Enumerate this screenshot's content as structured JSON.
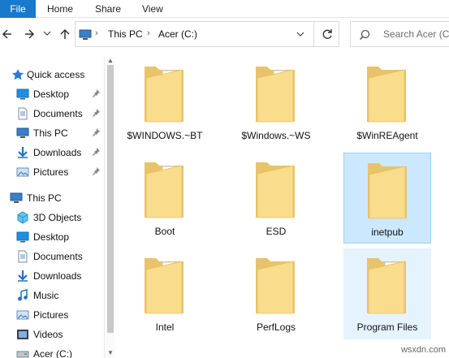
{
  "ribbon": {
    "tabs": [
      {
        "label": "File"
      },
      {
        "label": "Home"
      },
      {
        "label": "Share"
      },
      {
        "label": "View"
      }
    ]
  },
  "address": {
    "crumbs": [
      "This PC",
      "Acer (C:)"
    ],
    "search_placeholder": "Search Acer (C:)"
  },
  "sidebar": {
    "quick_access_label": "Quick access",
    "quick_items": [
      {
        "label": "Desktop",
        "icon": "desktop-icon",
        "pinned": true
      },
      {
        "label": "Documents",
        "icon": "documents-icon",
        "pinned": true
      },
      {
        "label": "This PC",
        "icon": "pc-icon",
        "pinned": true
      },
      {
        "label": "Downloads",
        "icon": "downloads-icon",
        "pinned": true
      },
      {
        "label": "Pictures",
        "icon": "pictures-icon",
        "pinned": true
      }
    ],
    "this_pc_label": "This PC",
    "pc_items": [
      {
        "label": "3D Objects",
        "icon": "3d-objects-icon"
      },
      {
        "label": "Desktop",
        "icon": "desktop-icon"
      },
      {
        "label": "Documents",
        "icon": "documents-icon"
      },
      {
        "label": "Downloads",
        "icon": "downloads-icon"
      },
      {
        "label": "Music",
        "icon": "music-icon"
      },
      {
        "label": "Pictures",
        "icon": "pictures-icon"
      },
      {
        "label": "Videos",
        "icon": "videos-icon"
      },
      {
        "label": "Acer (C:)",
        "icon": "drive-icon"
      }
    ]
  },
  "folders": [
    {
      "name": "$WINDOWS.~BT",
      "has_files": true,
      "state": ""
    },
    {
      "name": "$Windows.~WS",
      "has_files": true,
      "state": ""
    },
    {
      "name": "$WinREAgent",
      "has_files": false,
      "state": ""
    },
    {
      "name": "Boot",
      "has_files": true,
      "state": ""
    },
    {
      "name": "ESD",
      "has_files": false,
      "state": ""
    },
    {
      "name": "inetpub",
      "has_files": false,
      "state": "selected"
    },
    {
      "name": "Intel",
      "has_files": true,
      "state": ""
    },
    {
      "name": "PerfLogs",
      "has_files": false,
      "state": ""
    },
    {
      "name": "Program Files",
      "has_files": true,
      "state": "hover"
    }
  ],
  "watermark": "wsxdn.com",
  "colors": {
    "file_tab": "#1979ca",
    "selected_bg": "#cce8ff",
    "hover_bg": "#e5f3ff",
    "folder_back": "#e8c36a",
    "folder_front": "#f9dc8c"
  }
}
